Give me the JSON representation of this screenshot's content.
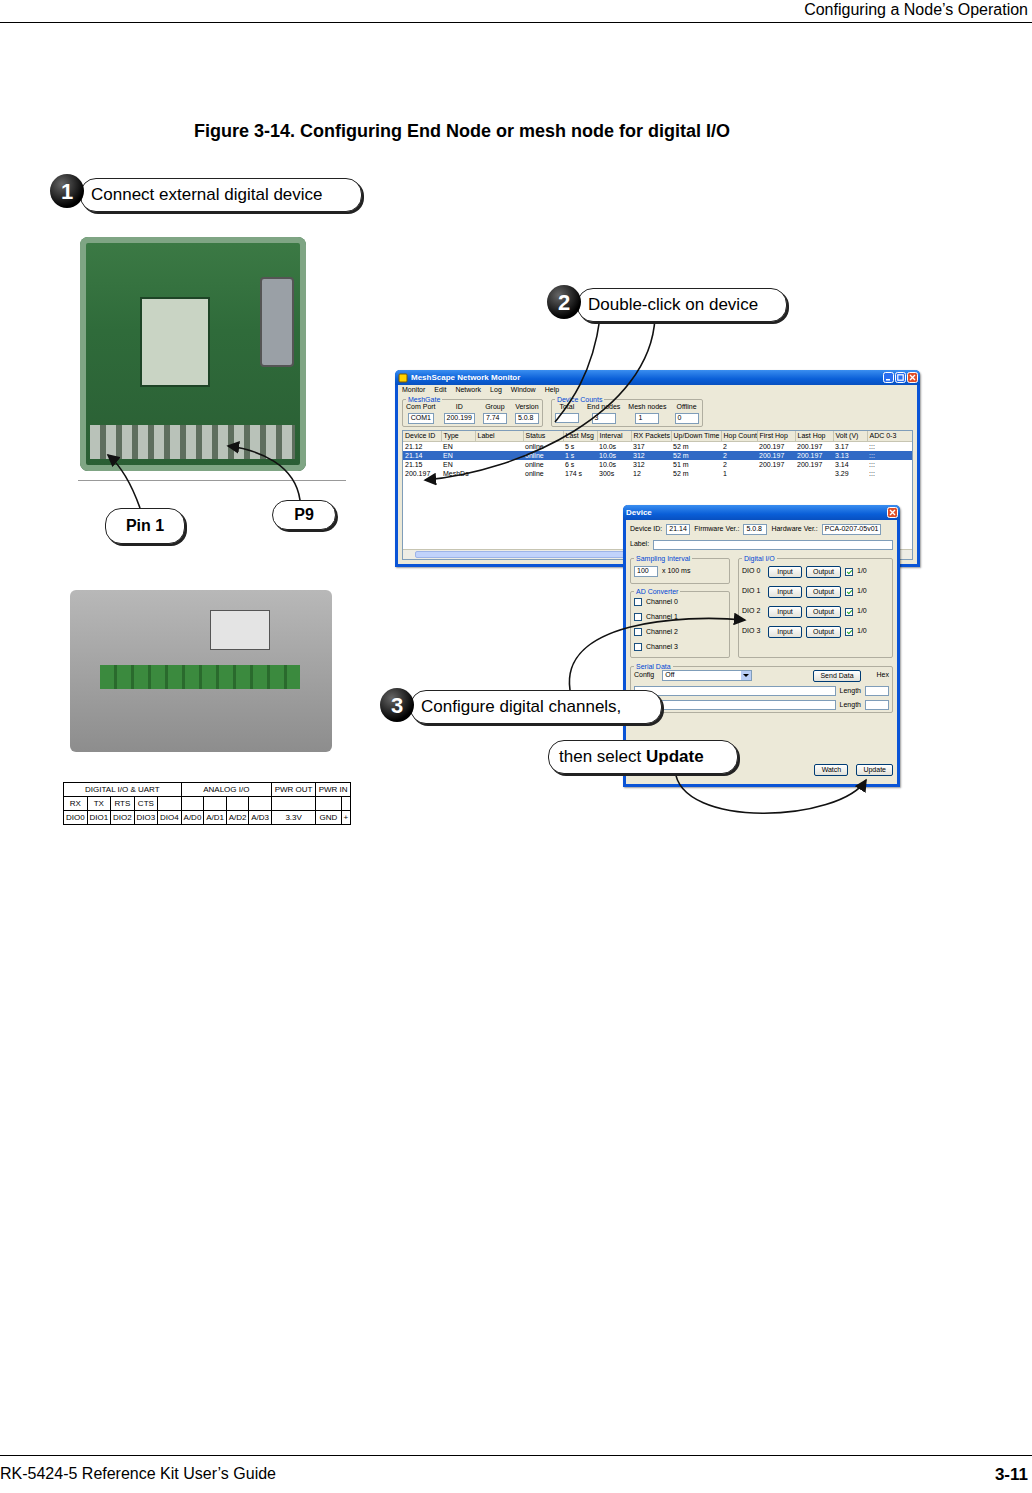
{
  "header": {
    "title": "Configuring a Node’s Operation"
  },
  "figure": {
    "caption": "Figure 3-14. Configuring End Node or mesh node for digital I/O"
  },
  "callouts": [
    {
      "number": "1",
      "text": "Connect external digital device"
    },
    {
      "number": "2",
      "text": "Double-click on device"
    },
    {
      "number": "3",
      "text": "Configure digital channels,",
      "text2": "then select",
      "emphasis": "Update"
    }
  ],
  "board_labels": [
    "Pin 1",
    "P9"
  ],
  "pinout": {
    "groups": [
      "DIGITAL I/O & UART",
      "ANALOG I/O",
      "PWR OUT",
      "PWR IN"
    ],
    "signals": [
      "RX",
      "TX",
      "RTS",
      "CTS",
      "",
      "",
      "",
      "",
      "",
      "",
      "",
      ""
    ],
    "pins": [
      "DIO0",
      "DIO1",
      "DIO2",
      "DIO3",
      "DIO4",
      "A/D0",
      "A/D1",
      "A/D2",
      "A/D3",
      "3.3V",
      "GND",
      "+"
    ]
  },
  "monitor": {
    "title": "MeshScape Network Monitor",
    "menu": [
      "Monitor",
      "Edit",
      "Network",
      "Log",
      "Window",
      "Help"
    ],
    "meshgate": {
      "legend": "MeshGate",
      "fields": [
        {
          "label": "Com Port",
          "value": "COM1"
        },
        {
          "label": "ID",
          "value": "200.199"
        },
        {
          "label": "Group",
          "value": "7.74"
        },
        {
          "label": "Version",
          "value": "5.0.8"
        }
      ]
    },
    "device_counts": {
      "legend": "Device Counts",
      "fields": [
        {
          "label": "Total",
          "value": ""
        },
        {
          "label": "End nodes",
          "value": "3"
        },
        {
          "label": "Mesh nodes",
          "value": "1"
        },
        {
          "label": "Offline",
          "value": "0"
        }
      ]
    },
    "columns": [
      "Device ID",
      "Type",
      "Label",
      "Status",
      "Last Msg",
      "Interval",
      "RX Packets",
      "Up/Down Time",
      "Hop Count",
      "First Hop",
      "Last Hop",
      "Volt (V)",
      "ADC 0-3"
    ],
    "rows": [
      {
        "cells": [
          "21.12",
          "EN",
          "",
          "online",
          "5 s",
          "10.0s",
          "317",
          "52 m",
          "2",
          "200.197",
          "200.197",
          "3.17",
          ":::"
        ],
        "selected": false
      },
      {
        "cells": [
          "21.14",
          "EN",
          "",
          "online",
          "1 s",
          "10.0s",
          "312",
          "52 m",
          "2",
          "200.197",
          "200.197",
          "3.13",
          ":::"
        ],
        "selected": true
      },
      {
        "cells": [
          "21.15",
          "EN",
          "",
          "online",
          "6 s",
          "10.0s",
          "312",
          "51 m",
          "2",
          "200.197",
          "200.197",
          "3.14",
          ":::"
        ],
        "selected": false
      },
      {
        "cells": [
          "200.197",
          "MeshDs",
          "",
          "online",
          "174 s",
          "300s",
          "12",
          "52 m",
          "1",
          "",
          "",
          "3.29",
          ":::"
        ],
        "selected": false
      }
    ]
  },
  "device": {
    "title": "Device",
    "info": [
      {
        "label": "Device ID:",
        "value": "21.14"
      },
      {
        "label": "Firmware Ver.:",
        "value": "5.0.8"
      },
      {
        "label": "Hardware Ver.:",
        "value": "PCA-0207-05v01"
      }
    ],
    "label_field": {
      "label": "Label:",
      "value": ""
    },
    "sampling": {
      "legend": "Sampling Interval",
      "value": "100",
      "unit": "x 100 ms"
    },
    "ad": {
      "legend": "AD Converter",
      "channels": [
        {
          "label": "Channel 0",
          "checked": false
        },
        {
          "label": "Channel 1",
          "checked": false
        },
        {
          "label": "Channel 2",
          "checked": false
        },
        {
          "label": "Channel 3",
          "checked": false
        }
      ]
    },
    "dio": {
      "legend": "Digital I/O",
      "items": [
        {
          "label": "DIO 0",
          "input": "Input",
          "output": "Output",
          "checked": true,
          "state": "1/0"
        },
        {
          "label": "DIO 1",
          "input": "Input",
          "output": "Output",
          "checked": true,
          "state": "1/0"
        },
        {
          "label": "DIO 2",
          "input": "Input",
          "output": "Output",
          "checked": true,
          "state": "1/0"
        },
        {
          "label": "DIO 3",
          "input": "Input",
          "output": "Output",
          "checked": true,
          "state": "1/0"
        }
      ]
    },
    "serial": {
      "legend": "Serial Data",
      "config_label": "Config",
      "config_value": "Off",
      "send": "Send Data",
      "hex": "Hex",
      "lengths": [
        "Length",
        "Length"
      ]
    },
    "buttons": [
      "Watch",
      "Update"
    ]
  },
  "footer": {
    "left": "RK-5424-5 Reference Kit User’s Guide",
    "page": "3-11"
  }
}
